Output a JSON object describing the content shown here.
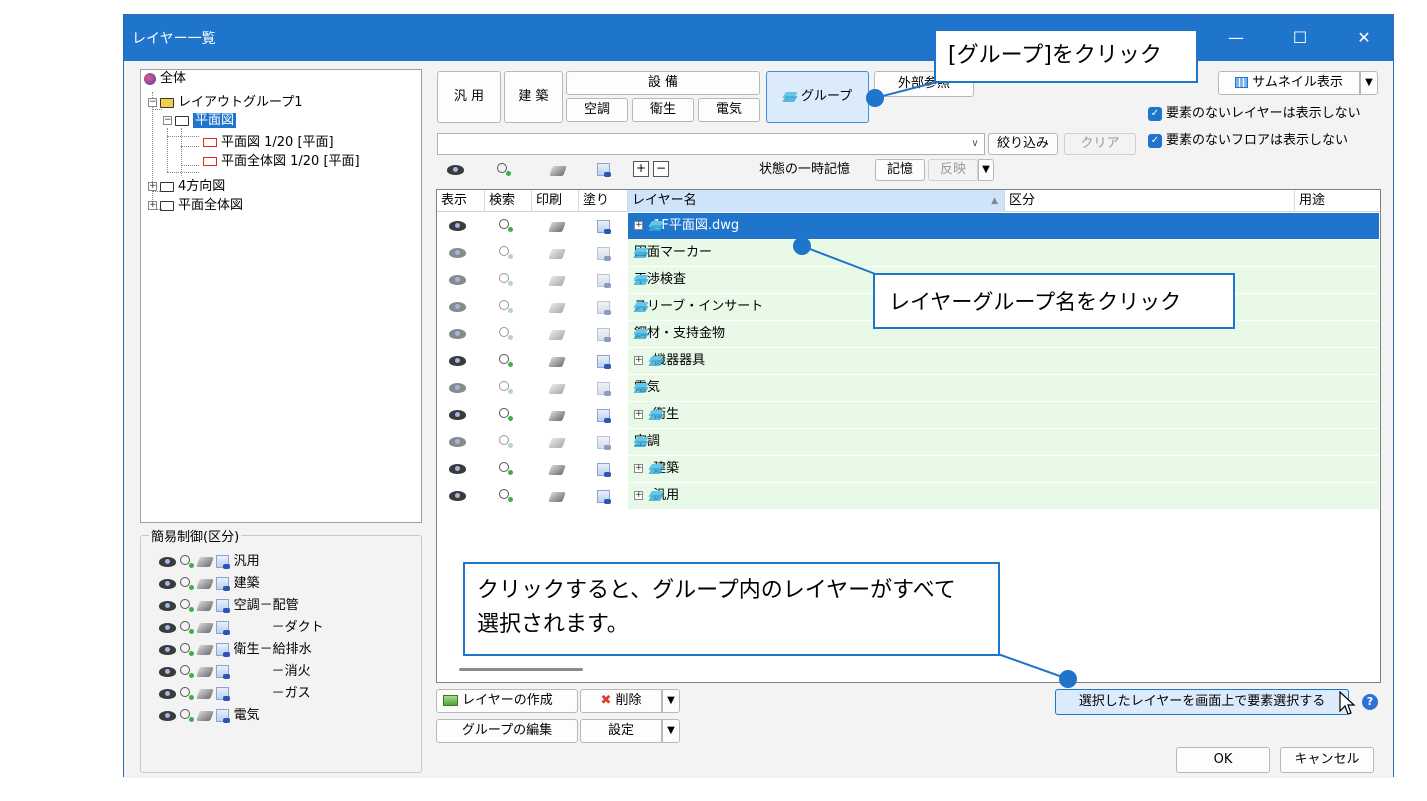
{
  "window": {
    "title": "レイヤー一覧",
    "minimize_icon": "minimize-icon",
    "maximize_icon": "maximize-icon",
    "close_icon": "close-icon"
  },
  "tree": {
    "root": "全体",
    "group1": "レイアウトグループ1",
    "plan": "平面図",
    "plan_sub1": "平面図 1/20 [平面]",
    "plan_sub2": "平面全体図 1/20 [平面]",
    "four_dir": "4方向図",
    "plan_all": "平面全体図"
  },
  "simple_control": {
    "caption": "簡易制御(区分)",
    "rows": [
      "汎用",
      "建築",
      "空調－配管",
      "－ダクト",
      "衛生－給排水",
      "－消火",
      "－ガス",
      "電気"
    ]
  },
  "category_buttons": {
    "general": "汎 用",
    "architecture": "建 築",
    "equipment": "設 備",
    "hvac": "空調",
    "sanitary": "衛生",
    "electric": "電気",
    "group": "グループ",
    "external_ref": "外部参照"
  },
  "view_options": {
    "thumbnail": "サムネイル表示",
    "hide_empty_layers": "要素のないレイヤーは表示しない",
    "hide_empty_floors": "要素のないフロアは表示しない"
  },
  "filter": {
    "value": "",
    "narrow_button": "絞り込み",
    "clear_button": "クリア"
  },
  "state_memory": {
    "label": "状態の一時記憶",
    "remember": "記憶",
    "reflect": "反映"
  },
  "grid": {
    "columns": [
      "表示",
      "検索",
      "印刷",
      "塗り",
      "レイヤー名",
      "区分",
      "用途"
    ],
    "rows": [
      {
        "name": "1F平面図.dwg",
        "expandable": true,
        "selected": true,
        "active": true
      },
      {
        "name": "図面マーカー",
        "expandable": false,
        "selected": false,
        "active": false
      },
      {
        "name": "干渉検査",
        "expandable": false,
        "selected": false,
        "active": false
      },
      {
        "name": "スリーブ・インサート",
        "expandable": false,
        "selected": false,
        "active": false
      },
      {
        "name": "鋼材・支持金物",
        "expandable": false,
        "selected": false,
        "active": false
      },
      {
        "name": "機器器具",
        "expandable": true,
        "selected": false,
        "active": true
      },
      {
        "name": "電気",
        "expandable": false,
        "selected": false,
        "active": false
      },
      {
        "name": "衛生",
        "expandable": true,
        "selected": false,
        "active": true
      },
      {
        "name": "空調",
        "expandable": false,
        "selected": false,
        "active": false
      },
      {
        "name": "建築",
        "expandable": true,
        "selected": false,
        "active": true
      },
      {
        "name": "汎用",
        "expandable": true,
        "selected": false,
        "active": true
      }
    ]
  },
  "bottom": {
    "create_layer": "レイヤーの作成",
    "delete": "削除",
    "edit_group": "グループの編集",
    "settings": "設定",
    "select_on_screen": "選択したレイヤーを画面上で要素選択する",
    "ok": "OK",
    "cancel": "キャンセル"
  },
  "callouts": {
    "group_click": "[グループ]をクリック",
    "name_click": "レイヤーグループ名をクリック",
    "select_note_line1": "クリックすると、グループ内のレイヤーがすべて",
    "select_note_line2": "選択されます。"
  },
  "colors": {
    "accent": "#1f74cc",
    "row_bg": "#e8f9e8",
    "selected_bg": "#1f74cc"
  }
}
